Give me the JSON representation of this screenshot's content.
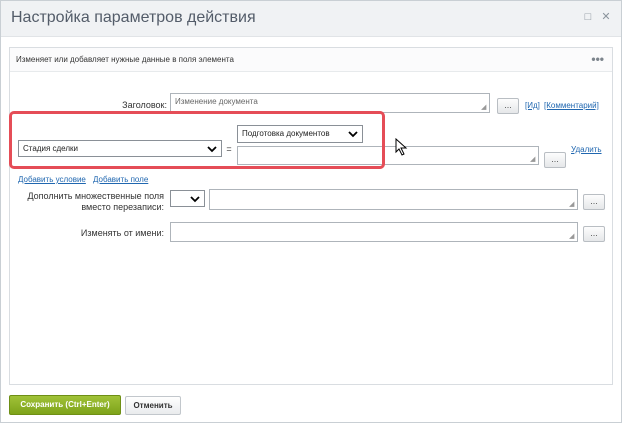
{
  "window": {
    "title": "Настройка параметров действия",
    "minimize_icon": "minimize-icon",
    "close_icon": "close-icon"
  },
  "description": {
    "text": "Изменяет или добавляет нужные данные в поля элемента",
    "more": "•••"
  },
  "title_row": {
    "label": "Заголовок:",
    "value": "Изменение документа",
    "dots": "...",
    "id_link": "[Ид]",
    "comment_link": "[Комментарий]"
  },
  "condition": {
    "field_select": "Стадия сделки",
    "equals": "=",
    "value_select": "Подготовка документов",
    "value_text": "",
    "dots": "...",
    "delete_link": "Удалить"
  },
  "links": {
    "add_condition": "Добавить условие",
    "add_field": "Добавить поле"
  },
  "multi_row": {
    "label_line1": "Дополнить множественные поля",
    "label_line2": "вместо перезаписи:",
    "select_value": "",
    "text_value": "",
    "dots": "..."
  },
  "as_user_row": {
    "label": "Изменять от имени:",
    "value": "",
    "dots": "..."
  },
  "footer": {
    "save": "Сохранить (Ctrl+Enter)",
    "cancel": "Отменить"
  },
  "colors": {
    "highlight": "#e54d57",
    "save_button": "#8db12a",
    "link": "#2067b0"
  }
}
